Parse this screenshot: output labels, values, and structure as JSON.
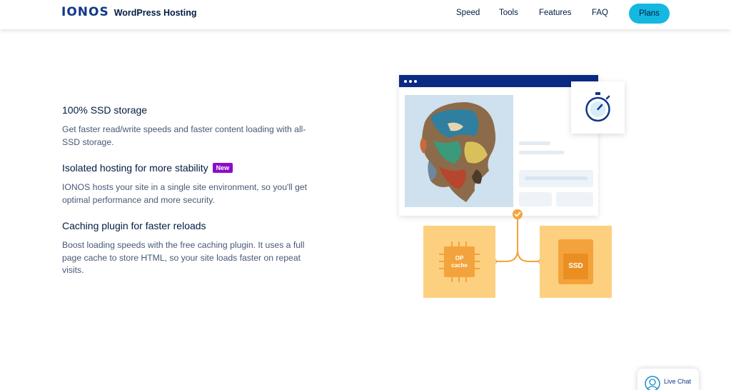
{
  "header": {
    "logo": "IONOS",
    "product": "WordPress Hosting",
    "nav": [
      "Speed",
      "Tools",
      "Features",
      "FAQ"
    ],
    "cta": "Plans"
  },
  "features": [
    {
      "title": "100% SSD storage",
      "text": "Get faster read/write speeds and faster content loading with all-SSD storage."
    },
    {
      "title": "Isolated hosting for more stability",
      "badge": "New",
      "text": "IONOS hosts your site in a single site environment, so you'll get optimal performance and more security."
    },
    {
      "title": "Caching plugin for faster reloads",
      "text": "Boost loading speeds with the free caching plugin. It uses a full page cache to store HTML, so your site loads faster on repeat visits."
    }
  ],
  "illustration": {
    "chip_label_1": "OP",
    "chip_label_2": "cache",
    "ssd_label": "SSD"
  },
  "chat": {
    "label": "Live Chat"
  },
  "colors": {
    "brand_blue": "#11388a",
    "accent_cyan": "#14b8e0",
    "badge_purple": "#8e0bc9",
    "orange": "#f3a33c"
  }
}
